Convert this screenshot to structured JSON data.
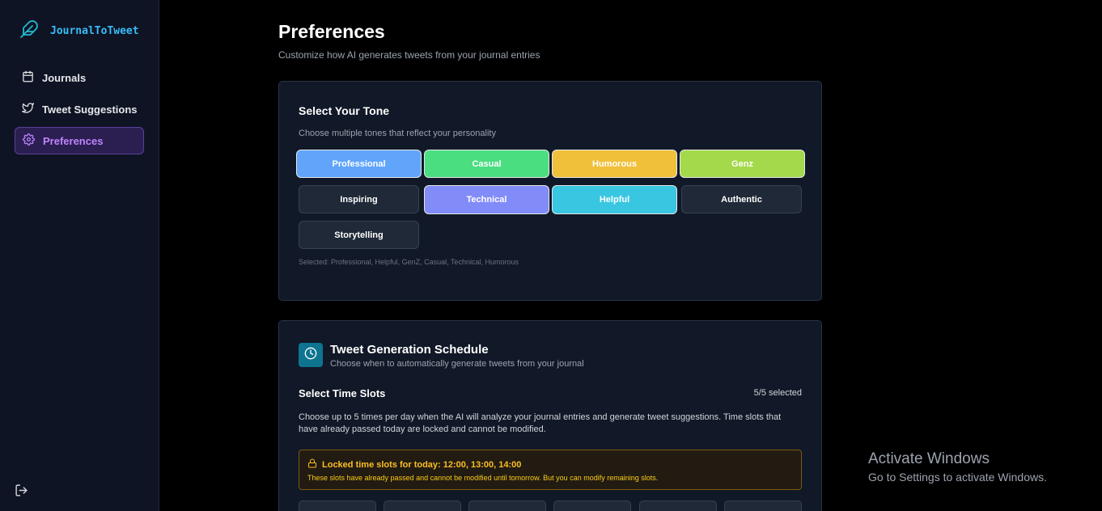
{
  "app": {
    "name": "JournalToTweet"
  },
  "sidebar": {
    "items": [
      {
        "label": "Journals",
        "icon": "calendar-icon"
      },
      {
        "label": "Tweet Suggestions",
        "icon": "twitter-icon"
      },
      {
        "label": "Preferences",
        "icon": "gear-icon"
      }
    ],
    "logout_icon": "logout-icon"
  },
  "page": {
    "title": "Preferences",
    "subtitle": "Customize how AI generates tweets from your journal entries"
  },
  "tone": {
    "title": "Select Your Tone",
    "description": "Choose multiple tones that reflect your personality",
    "options": [
      {
        "label": "Professional",
        "selected": true,
        "color": "#60a5fa"
      },
      {
        "label": "Casual",
        "selected": true,
        "color": "#4ade80"
      },
      {
        "label": "Humorous",
        "selected": true,
        "color": "#f0c03a"
      },
      {
        "label": "Genz",
        "selected": true,
        "color": "#a3d94a"
      },
      {
        "label": "Inspiring",
        "selected": false,
        "color": "#1f2937"
      },
      {
        "label": "Technical",
        "selected": true,
        "color": "#818cf8"
      },
      {
        "label": "Helpful",
        "selected": true,
        "color": "#38c6e0"
      },
      {
        "label": "Authentic",
        "selected": false,
        "color": "#1f2937"
      },
      {
        "label": "Storytelling",
        "selected": false,
        "color": "#1f2937"
      }
    ],
    "selected_text": "Selected: Professional, Helpful, GenZ, Casual, Technical, Humorous"
  },
  "schedule": {
    "title": "Tweet Generation Schedule",
    "subtitle": "Choose when to automatically generate tweets from your journal",
    "slots_title": "Select Time Slots",
    "slots_count": "5/5 selected",
    "slots_description": "Choose up to 5 times per day when the AI will analyze your journal entries and generate tweet suggestions. Time slots that have already passed today are locked and cannot be modified.",
    "locked_title": "Locked time slots for today: 12:00, 13:00, 14:00",
    "locked_note": "These slots have already passed and cannot be modified until tomorrow. But you can modify remaining slots."
  },
  "watermark": {
    "line1": "Activate Windows",
    "line2": "Go to Settings to activate Windows."
  }
}
